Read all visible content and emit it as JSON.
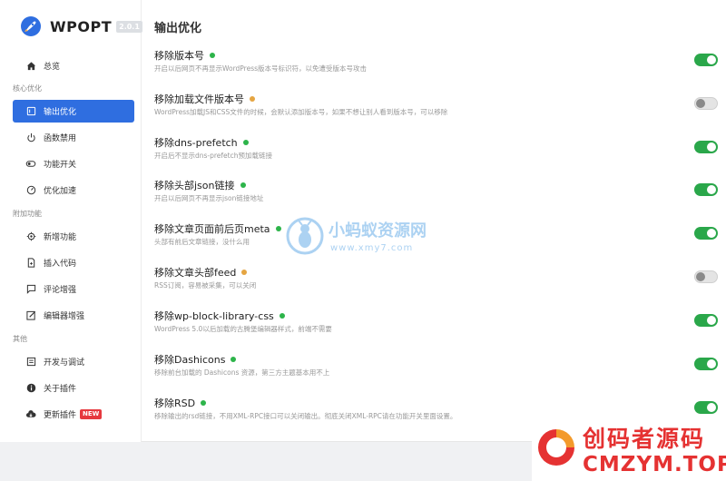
{
  "app": {
    "name": "WPOPT",
    "version": "2.0.1"
  },
  "sidebar": {
    "home": "总览",
    "groups": {
      "core": "核心优化",
      "extra": "附加功能",
      "other": "其他"
    },
    "items": [
      {
        "label": "输出优化",
        "icon": "optimize-icon",
        "active": true
      },
      {
        "label": "函数禁用",
        "icon": "power-icon"
      },
      {
        "label": "功能开关",
        "icon": "switch-icon"
      },
      {
        "label": "优化加速",
        "icon": "speed-icon"
      },
      {
        "label": "新增功能",
        "icon": "gear-icon"
      },
      {
        "label": "插入代码",
        "icon": "code-file-icon"
      },
      {
        "label": "评论增强",
        "icon": "comment-icon"
      },
      {
        "label": "编辑器增强",
        "icon": "edit-icon"
      },
      {
        "label": "开发与调试",
        "icon": "debug-icon"
      },
      {
        "label": "关于插件",
        "icon": "info-icon"
      },
      {
        "label": "更新插件",
        "icon": "cloud-download-icon",
        "badge": "NEW"
      }
    ]
  },
  "main": {
    "title": "输出优化",
    "settings": [
      {
        "title": "移除版本号",
        "status": "green",
        "desc": "开启以后网页不再显示WordPress版本号标识符，以免遭受版本号攻击",
        "enabled": true
      },
      {
        "title": "移除加载文件版本号",
        "status": "orange",
        "desc": "WordPress加载JS和CSS文件的时候，会默认添加版本号，如果不想让别人看到版本号，可以移除",
        "enabled": false
      },
      {
        "title": "移除dns-prefetch",
        "status": "green",
        "desc": "开启后不显示dns-prefetch预加载链接",
        "enabled": true
      },
      {
        "title": "移除头部json链接",
        "status": "green",
        "desc": "开启以后网页不再显示json链接地址",
        "enabled": true
      },
      {
        "title": "移除文章页面前后页meta",
        "status": "green",
        "desc": "头部有前后文章链接，没什么用",
        "enabled": true
      },
      {
        "title": "移除文章头部feed",
        "status": "orange",
        "desc": "RSS订阅，容易被采集，可以关闭",
        "enabled": false
      },
      {
        "title": "移除wp-block-library-css",
        "status": "green",
        "desc": "WordPress 5.0以后加载的古腾堡编辑器样式，前端不需要",
        "enabled": true
      },
      {
        "title": "移除Dashicons",
        "status": "green",
        "desc": "移除前台加载的 Dashicons 资源，第三方主题基本用不上",
        "enabled": true
      },
      {
        "title": "移除RSD",
        "status": "green",
        "desc": "移除输出的rsd链接，不用XML-RPC接口可以关闭输出。彻底关闭XML-RPC请在功能开关里面设置。",
        "enabled": true
      }
    ]
  },
  "watermarks": {
    "top_cn": "小蚂蚁资源网",
    "top_url": "www.xmy7.com",
    "bottom_cn": "创码者源码",
    "bottom_en": "CMZYM.TOP"
  },
  "colors": {
    "accent": "#2f6ee0",
    "toggle_on": "#2aa74a",
    "dot_green": "#2db44a",
    "dot_orange": "#e5a542",
    "watermark_red": "#e53232"
  }
}
